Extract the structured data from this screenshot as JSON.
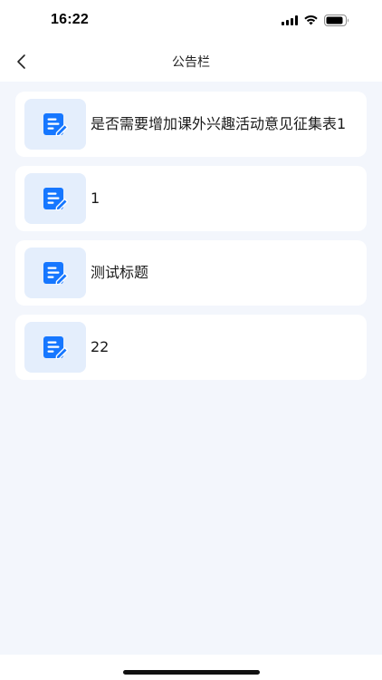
{
  "status_bar": {
    "time": "16:22",
    "icons": [
      "cellular-signal-icon",
      "wifi-icon",
      "battery-icon"
    ]
  },
  "nav": {
    "back_icon": "chevron-left-icon",
    "title": "公告栏"
  },
  "notices": [
    {
      "title": "是否需要增加课外兴趣活动意见征集表1",
      "icon": "document-edit-icon"
    },
    {
      "title": "1",
      "icon": "document-edit-icon"
    },
    {
      "title": "测试标题",
      "icon": "document-edit-icon"
    },
    {
      "title": "22",
      "icon": "document-edit-icon"
    }
  ],
  "colors": {
    "accent": "#1677ff",
    "icon_bg": "#e4eefc",
    "page_bg": "#f3f6fc",
    "card_bg": "#ffffff"
  }
}
